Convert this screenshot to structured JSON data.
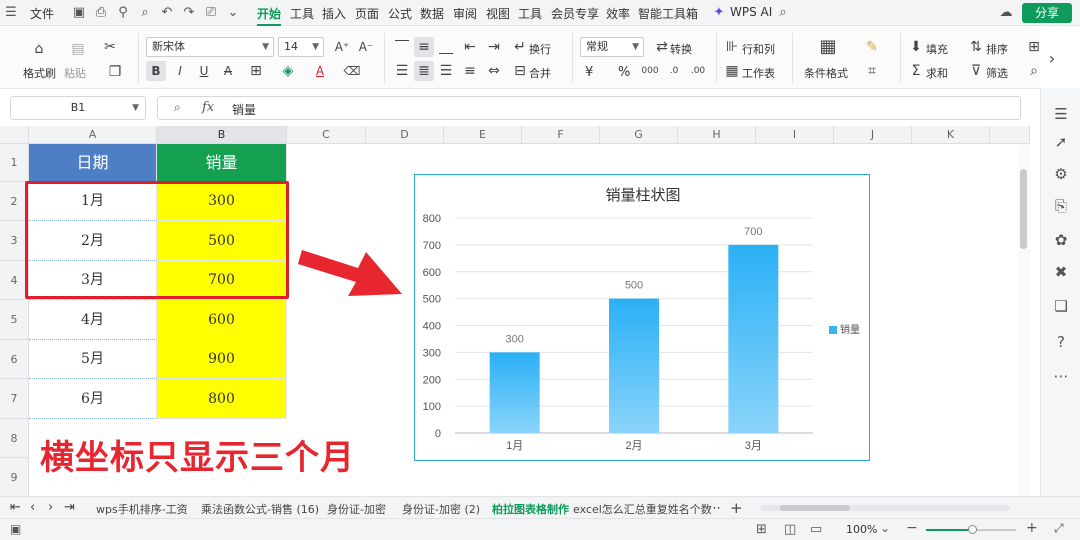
{
  "menubar": {
    "file": "文件",
    "tabs": [
      "开始",
      "工具",
      "插入",
      "页面",
      "公式",
      "数据",
      "审阅",
      "视图",
      "工具",
      "会员专享",
      "效率",
      "智能工具箱"
    ],
    "wps_ai": "WPS AI",
    "share": "分享"
  },
  "ribbon": {
    "format_painter": "格式刷",
    "paste": "粘贴",
    "font_name": "新宋体",
    "font_size": "14",
    "wrap": "换行",
    "merge": "合并",
    "number_format": "常规",
    "convert": "转换",
    "row_col": "行和列",
    "sheet": "工作表",
    "cond_format": "条件格式",
    "fill": "填充",
    "sort": "排序",
    "sum": "求和",
    "filter": "筛选",
    "currency": "¥",
    "percent": "%"
  },
  "formula_bar": {
    "name_box": "B1",
    "fx": "fx",
    "content": "销量"
  },
  "sheet": {
    "columns": [
      "A",
      "B",
      "C",
      "D",
      "E",
      "F",
      "G",
      "H",
      "I",
      "J",
      "K"
    ],
    "rows": [
      "1",
      "2",
      "3",
      "4",
      "5",
      "6",
      "7",
      "8",
      "9"
    ],
    "header_date": "日期",
    "header_sales": "销量",
    "data": [
      {
        "month": "1月",
        "sales": "300"
      },
      {
        "month": "2月",
        "sales": "500"
      },
      {
        "month": "3月",
        "sales": "700"
      },
      {
        "month": "4月",
        "sales": "600"
      },
      {
        "month": "5月",
        "sales": "900"
      },
      {
        "month": "6月",
        "sales": "800"
      }
    ],
    "annotation": "横坐标只显示三个月"
  },
  "chart_data": {
    "type": "bar",
    "title": "销量柱状图",
    "categories": [
      "1月",
      "2月",
      "3月"
    ],
    "series": [
      {
        "name": "销量",
        "values": [
          300,
          500,
          700
        ]
      }
    ],
    "ylim": [
      0,
      800
    ],
    "yticks": [
      0,
      100,
      200,
      300,
      400,
      500,
      600,
      700,
      800
    ],
    "legend": "right",
    "grid": true,
    "bar_color": "#3ab3f0"
  },
  "sheet_tabs": [
    "wps手机排序-工资",
    "乘法函数公式-销售 (16)",
    "身份证-加密",
    "身份证-加密 (2)",
    "柏拉图表格制作",
    "excel怎么汇总重复姓名个数"
  ],
  "status": {
    "zoom": "100%"
  }
}
